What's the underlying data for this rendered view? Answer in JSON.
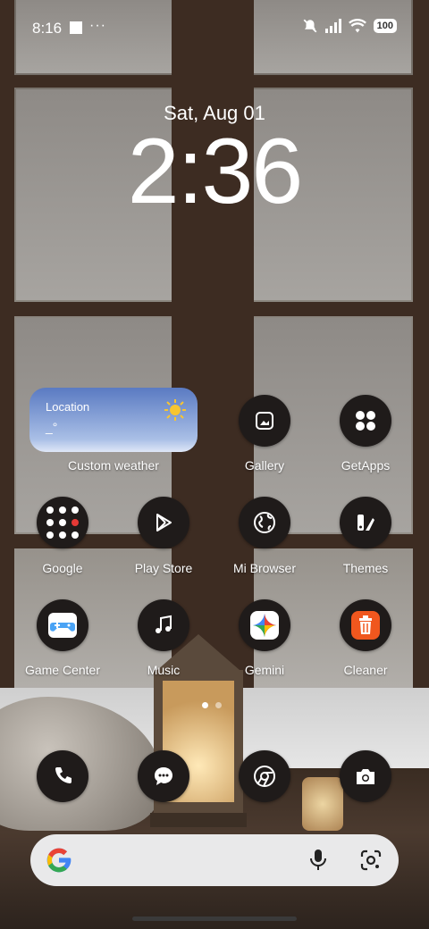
{
  "status_bar": {
    "time": "8:16",
    "overflow": "···",
    "battery": "100"
  },
  "lockclock": {
    "date": "Sat, Aug 01",
    "time": "2:36"
  },
  "weather_widget": {
    "location": "Location",
    "value": "_°",
    "label": "Custom weather"
  },
  "apps": {
    "gallery": "Gallery",
    "getapps": "GetApps",
    "google": "Google",
    "playstore": "Play Store",
    "mibrowser": "Mi Browser",
    "themes": "Themes",
    "gamecenter": "Game Center",
    "music": "Music",
    "gemini": "Gemini",
    "cleaner": "Cleaner"
  },
  "pager": {
    "pages": 2,
    "current": 1
  },
  "colors": {
    "cleaner_orange": "#f0571e",
    "gamecenter_blue": "#4aa3f5",
    "google_blue": "#4285f4",
    "google_red": "#ea4335",
    "google_yellow": "#fbbc05",
    "google_green": "#34a853"
  }
}
